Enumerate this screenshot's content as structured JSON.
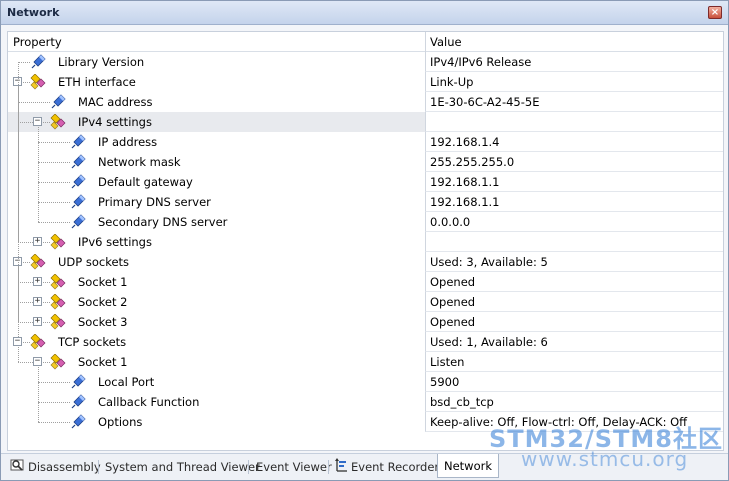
{
  "window": {
    "title": "Network",
    "close_glyph": "×"
  },
  "columns": {
    "property": "Property",
    "value": "Value"
  },
  "rows": [
    {
      "label": "Library Version",
      "value": "IPv4/IPv6 Release",
      "depth": 0,
      "kind": "item"
    },
    {
      "label": "ETH interface",
      "value": "Link-Up",
      "depth": 0,
      "kind": "group",
      "expanded": true
    },
    {
      "label": "MAC address",
      "value": "1E-30-6C-A2-45-5E",
      "depth": 1,
      "kind": "item"
    },
    {
      "label": "IPv4 settings",
      "value": "",
      "depth": 1,
      "kind": "group",
      "expanded": true,
      "selected": true
    },
    {
      "label": "IP address",
      "value": "192.168.1.4",
      "depth": 2,
      "kind": "item"
    },
    {
      "label": "Network mask",
      "value": "255.255.255.0",
      "depth": 2,
      "kind": "item"
    },
    {
      "label": "Default gateway",
      "value": "192.168.1.1",
      "depth": 2,
      "kind": "item"
    },
    {
      "label": "Primary DNS server",
      "value": "192.168.1.1",
      "depth": 2,
      "kind": "item"
    },
    {
      "label": "Secondary DNS server",
      "value": "0.0.0.0",
      "depth": 2,
      "kind": "item"
    },
    {
      "label": "IPv6 settings",
      "value": "",
      "depth": 1,
      "kind": "group",
      "expanded": false
    },
    {
      "label": "UDP sockets",
      "value": "Used: 3, Available: 5",
      "depth": 0,
      "kind": "group",
      "expanded": true
    },
    {
      "label": "Socket 1",
      "value": "Opened",
      "depth": 1,
      "kind": "group",
      "expanded": false
    },
    {
      "label": "Socket 2",
      "value": "Opened",
      "depth": 1,
      "kind": "group",
      "expanded": false
    },
    {
      "label": "Socket 3",
      "value": "Opened",
      "depth": 1,
      "kind": "group",
      "expanded": false
    },
    {
      "label": "TCP sockets",
      "value": "Used: 1, Available: 6",
      "depth": 0,
      "kind": "group",
      "expanded": true
    },
    {
      "label": "Socket 1",
      "value": "Listen",
      "depth": 1,
      "kind": "group",
      "expanded": true
    },
    {
      "label": "Local Port",
      "value": "5900",
      "depth": 2,
      "kind": "item"
    },
    {
      "label": "Callback Function",
      "value": "bsd_cb_tcp",
      "depth": 2,
      "kind": "item"
    },
    {
      "label": "Options",
      "value": "Keep-alive: Off, Flow-ctrl: Off, Delay-ACK: Off",
      "depth": 2,
      "kind": "item"
    }
  ],
  "tabs": [
    {
      "label": "Disassembly",
      "icon": "disassembly-icon",
      "active": false
    },
    {
      "label": "System and Thread Viewer",
      "active": false
    },
    {
      "label": "Event Viewer",
      "active": false
    },
    {
      "label": "Event Recorder",
      "icon": "event-recorder-icon",
      "active": false
    },
    {
      "label": "Network",
      "active": true
    }
  ],
  "watermark": {
    "line1": "STM32/STM8社区",
    "line2": "www.stmcu.org"
  },
  "colors": {
    "item_icon": "#3b6fd6",
    "group_icon_yellow": "#f2c200",
    "group_icon_pink": "#d45fb0"
  }
}
